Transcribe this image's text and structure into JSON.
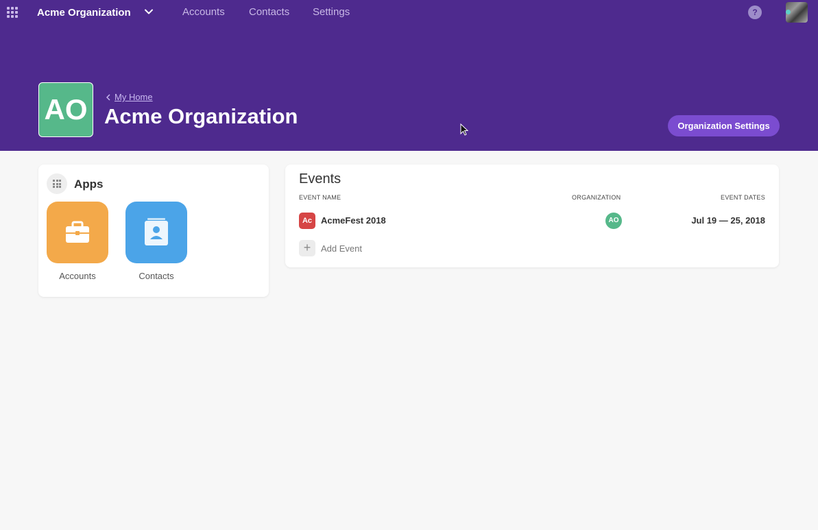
{
  "topnav": {
    "org_name": "Acme Organization",
    "links": [
      "Accounts",
      "Contacts",
      "Settings"
    ],
    "help_label": "?"
  },
  "header": {
    "org_initials": "AO",
    "breadcrumb": "My Home",
    "title": "Acme Organization",
    "settings_button": "Organization Settings"
  },
  "apps": {
    "title": "Apps",
    "items": [
      {
        "label": "Accounts",
        "color": "#f3a94a",
        "icon": "briefcase-icon"
      },
      {
        "label": "Contacts",
        "color": "#4ba4e8",
        "icon": "contact-card-icon"
      }
    ]
  },
  "events": {
    "title": "Events",
    "columns": [
      "EVENT NAME",
      "ORGANIZATION",
      "EVENT DATES"
    ],
    "rows": [
      {
        "badge": "Ac",
        "name": "AcmeFest 2018",
        "org_initials": "AO",
        "dates": "Jul 19 — 25, 2018"
      }
    ],
    "add_label": "Add Event"
  },
  "colors": {
    "header_bg": "#4e2a8e",
    "accent_button": "#7b4cd0",
    "org_green": "#56b88a",
    "event_red": "#d64545"
  }
}
